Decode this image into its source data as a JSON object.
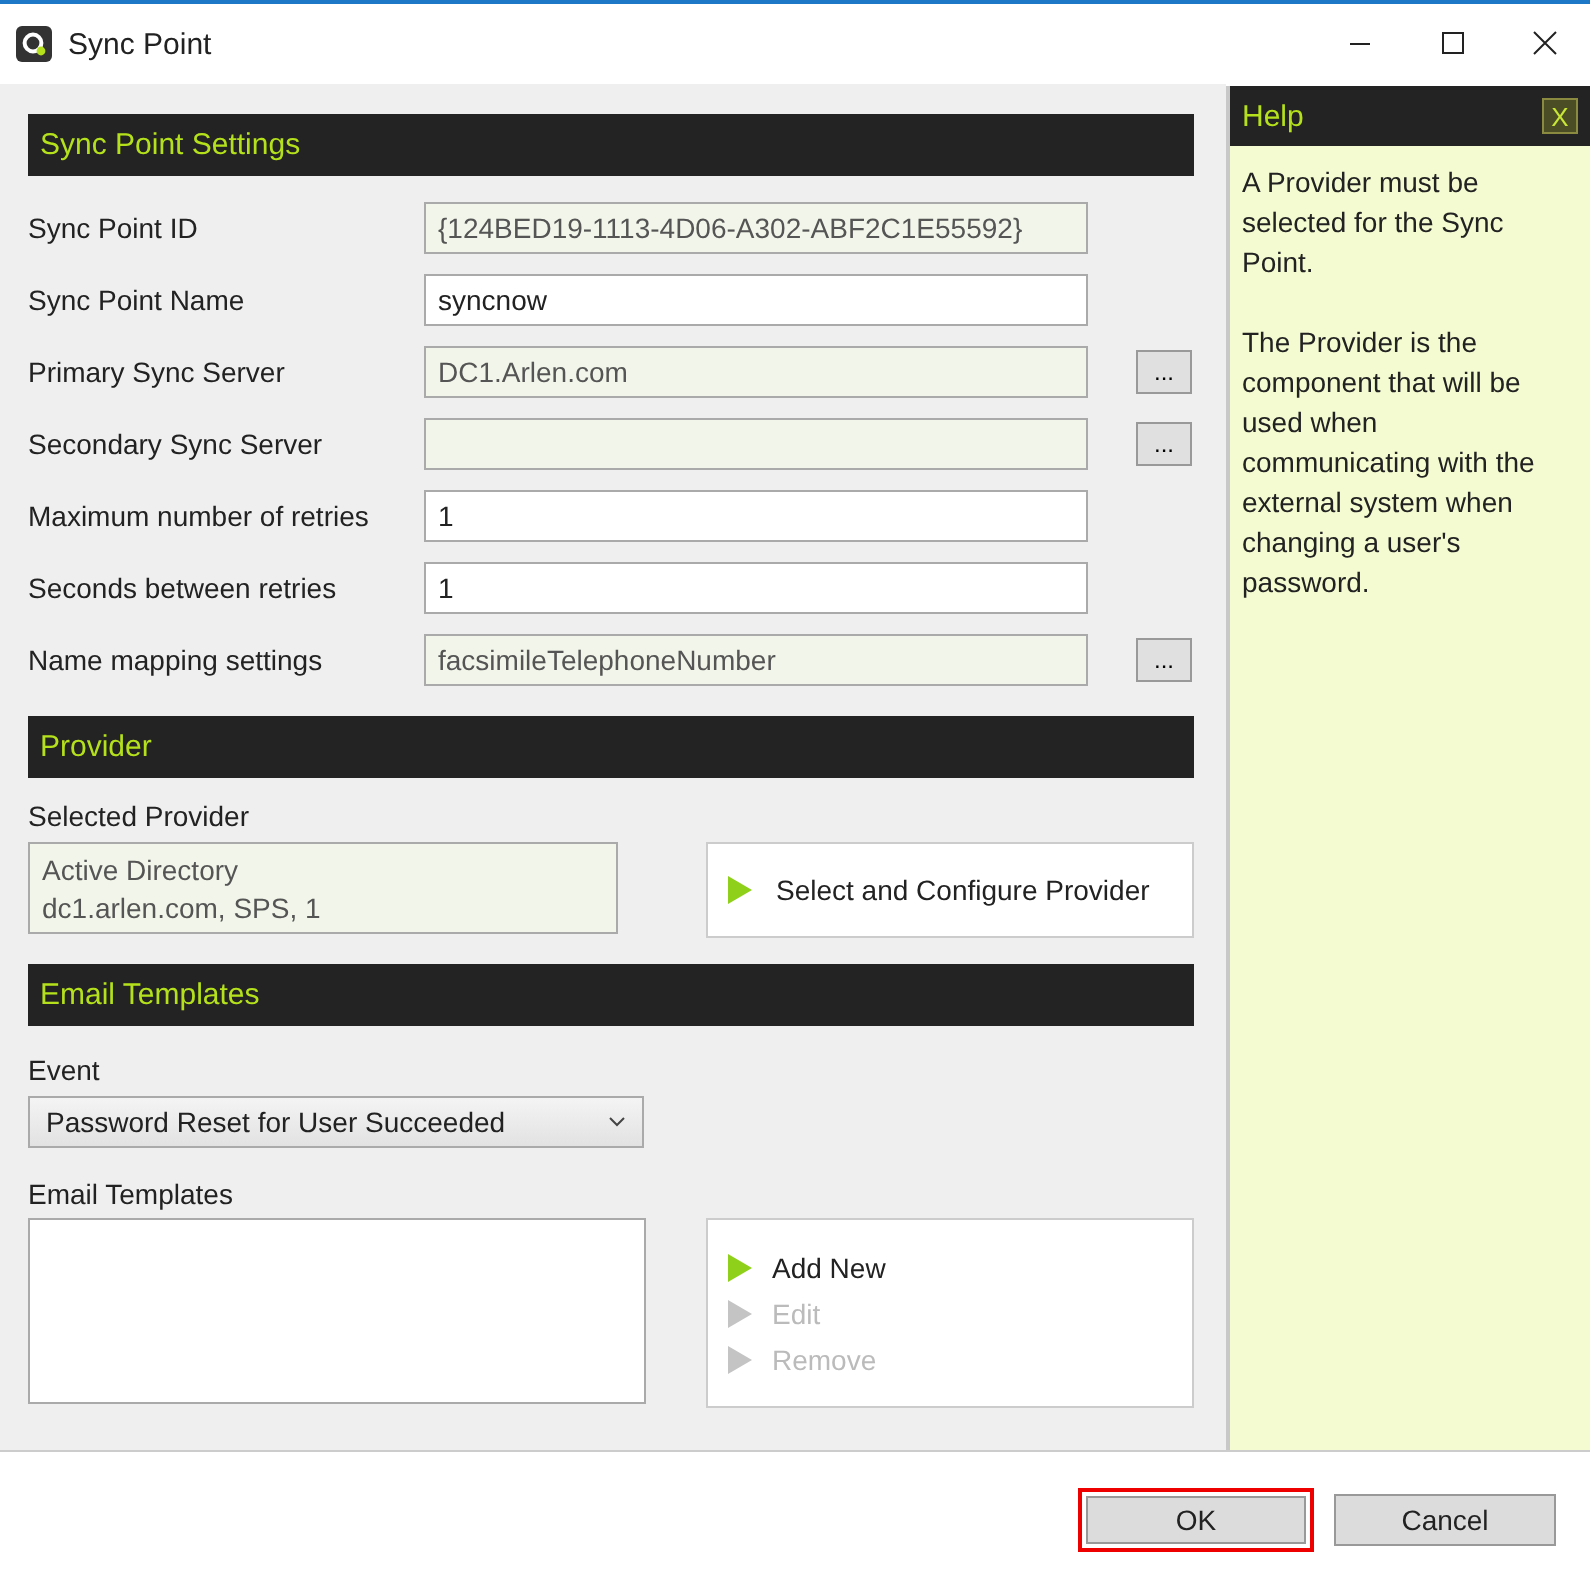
{
  "window": {
    "title": "Sync Point"
  },
  "settings": {
    "header": "Sync Point Settings",
    "fields": [
      {
        "label": "Sync Point ID",
        "value": "{124BED19-1113-4D06-A302-ABF2C1E55592}",
        "readonly": true
      },
      {
        "label": "Sync Point Name",
        "value": "syncnow",
        "readonly": false
      },
      {
        "label": "Primary Sync Server",
        "value": "DC1.Arlen.com",
        "readonly": true,
        "browse_button": "..."
      },
      {
        "label": "Secondary Sync Server",
        "readonly": true,
        "browse_button": "..."
      },
      {
        "label": "Maximum number of retries",
        "value": "1",
        "readonly": false
      },
      {
        "label": "Seconds between retries",
        "value": "1",
        "readonly": false
      },
      {
        "label": "Name mapping settings",
        "value": "facsimileTelephoneNumber",
        "readonly": true,
        "browse_button": "..."
      }
    ]
  },
  "provider": {
    "header": "Provider",
    "label": "Selected Provider",
    "lines": [
      "Active Directory",
      "dc1.arlen.com, SPS, 1"
    ],
    "action": "Select and Configure Provider"
  },
  "email_templates": {
    "header": "Email Templates",
    "event_label": "Event",
    "event_value": "Password Reset for User Succeeded",
    "list_label": "Email Templates",
    "actions": [
      {
        "label": "Add New",
        "disabled": false
      },
      {
        "label": "Edit",
        "disabled": true
      },
      {
        "label": "Remove",
        "disabled": true
      }
    ]
  },
  "help": {
    "title": "Help",
    "close": "X",
    "paragraphs": [
      "A Provider must be selected for the Sync Point.",
      "The Provider is the component that will be used when communicating with the external system when changing a user's password."
    ]
  },
  "buttons": [
    {
      "label": "OK",
      "focused": true
    },
    {
      "label": "Cancel",
      "focused": false
    }
  ]
}
